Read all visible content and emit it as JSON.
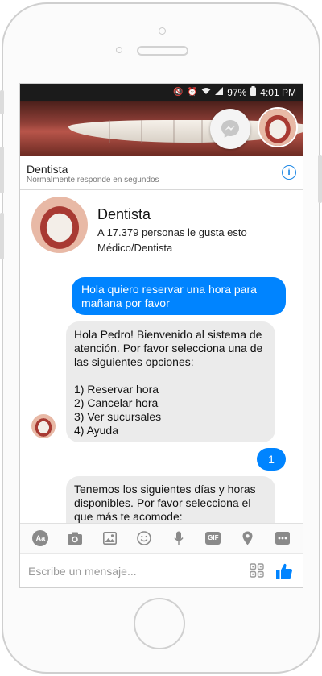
{
  "status_bar": {
    "battery": "97%",
    "time": "4:01 PM"
  },
  "header": {
    "name": "Dentista",
    "subtitle": "Normalmente responde en segundos"
  },
  "profile": {
    "title": "Dentista",
    "likes": "A 17.379 personas le gusta esto",
    "category": "Médico/Dentista"
  },
  "messages": [
    {
      "from": "user",
      "text": "Hola quiero reservar una hora para mañana por favor"
    },
    {
      "from": "bot",
      "text": "Hola Pedro! Bienvenido al sistema de atención. Por favor selecciona una de las siguientes opciones:\n\n1) Reservar hora\n2) Cancelar hora\n3) Ver sucursales\n4) Ayuda"
    },
    {
      "from": "user",
      "text": "1"
    },
    {
      "from": "bot",
      "text": "Tenemos los siguientes días y horas disponibles. Por favor selecciona el que más te acomode:"
    }
  ],
  "toolbar": {
    "aa_label": "Aa",
    "gif_label": "GIF"
  },
  "input": {
    "placeholder": "Escribe un mensaje..."
  },
  "colors": {
    "accent": "#0084ff",
    "bot_bubble": "#ebebeb"
  },
  "icons": [
    "camera-icon",
    "image-icon",
    "emoji-icon",
    "mic-icon",
    "location-icon",
    "more-icon",
    "qr-icon",
    "thumbs-up-icon",
    "info-icon",
    "messenger-icon"
  ]
}
